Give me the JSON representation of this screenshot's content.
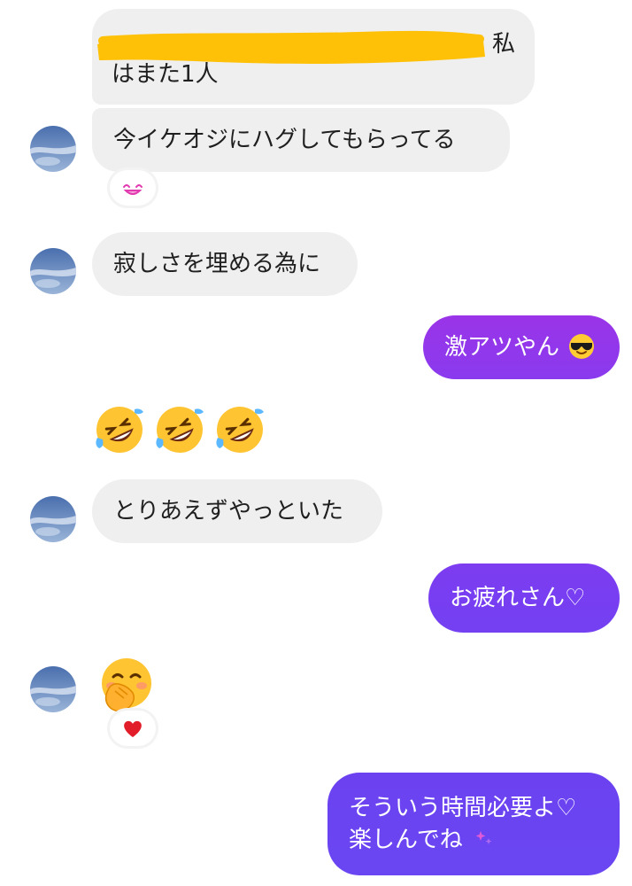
{
  "thread": {
    "messages": [
      {
        "side": "in",
        "text_lines": [
          "私",
          "はまた1人"
        ],
        "redacted": true
      },
      {
        "side": "in",
        "text": "今イケオジにハグしてもらってる",
        "reaction": "smile-face-icon"
      },
      {
        "side": "in",
        "text": "寂しさを埋める為に"
      },
      {
        "side": "out",
        "text": "激アツやん",
        "emoji": "sunglasses-face-emoji"
      },
      {
        "side": "out",
        "emoji_row": [
          "rolling-laughing-emoji",
          "rolling-laughing-emoji",
          "rolling-laughing-emoji"
        ]
      },
      {
        "side": "in",
        "text": "とりあえずやっといた"
      },
      {
        "side": "out",
        "text": "お疲れさん♡"
      },
      {
        "side": "in",
        "emoji": "hand-over-mouth-emoji",
        "reaction": "heart-icon"
      },
      {
        "side": "out",
        "text_lines": [
          "そういう時間必要よ♡",
          "楽しんでね"
        ],
        "trailing_emoji": "sparkle-icon"
      }
    ]
  },
  "colors": {
    "incoming_bubble": "#efefef",
    "outgoing_gradient_top": "#9a34e8",
    "outgoing_gradient_bottom": "#6a40f0",
    "redaction": "#ffc107",
    "heart": "#e11d2a",
    "reaction_face": "#e23bb0"
  }
}
